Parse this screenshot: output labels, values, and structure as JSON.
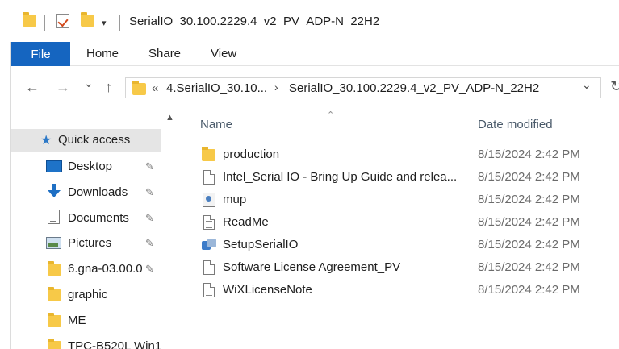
{
  "window": {
    "title": "SerialIO_30.100.2229.4_v2_PV_ADP-N_22H2",
    "quick_access_arrow": "▾"
  },
  "ribbon": {
    "tabs": [
      "File",
      "Home",
      "Share",
      "View"
    ]
  },
  "address": {
    "overflow": "«",
    "segments": [
      "4.SerialIO_30.10...",
      "SerialIO_30.100.2229.4_v2_PV_ADP-N_22H2"
    ],
    "separator": "›",
    "dropdown": "⌄"
  },
  "nav_buttons": {
    "back": "←",
    "forward": "→",
    "recent": "⌄",
    "up": "↑",
    "refresh": "↻"
  },
  "sidebar": {
    "quick_access_label": "Quick access",
    "items": [
      {
        "label": "Desktop",
        "icon": "desktop-icon",
        "pinned": true
      },
      {
        "label": "Downloads",
        "icon": "downloads-icon",
        "pinned": true
      },
      {
        "label": "Documents",
        "icon": "documents-icon",
        "pinned": true
      },
      {
        "label": "Pictures",
        "icon": "pictures-icon",
        "pinned": true
      },
      {
        "label": "6.gna-03.00.0",
        "icon": "folder-icon",
        "pinned": true
      },
      {
        "label": "graphic",
        "icon": "folder-icon",
        "pinned": false
      },
      {
        "label": "ME",
        "icon": "folder-icon",
        "pinned": false
      },
      {
        "label": "TPC-B520L Win1",
        "icon": "folder-icon",
        "pinned": false
      }
    ],
    "pin_glyph": "📌",
    "scroll_up": "▲"
  },
  "file_list": {
    "columns": [
      "Name",
      "Date modified"
    ],
    "sort_indicator": "⌃",
    "rows": [
      {
        "name": "production",
        "date": "8/15/2024 2:42 PM",
        "icon": "folder-icon"
      },
      {
        "name": "Intel_Serial IO - Bring Up Guide and relea...",
        "date": "8/15/2024 2:42 PM",
        "icon": "document-icon"
      },
      {
        "name": "mup",
        "date": "8/15/2024 2:42 PM",
        "icon": "config-file-icon"
      },
      {
        "name": "ReadMe",
        "date": "8/15/2024 2:42 PM",
        "icon": "text-file-icon"
      },
      {
        "name": "SetupSerialIO",
        "date": "8/15/2024 2:42 PM",
        "icon": "setup-exe-icon"
      },
      {
        "name": "Software License Agreement_PV",
        "date": "8/15/2024 2:42 PM",
        "icon": "document-icon"
      },
      {
        "name": "WiXLicenseNote",
        "date": "8/15/2024 2:42 PM",
        "icon": "text-file-icon"
      }
    ]
  },
  "colors": {
    "file_tab": "#1565c0",
    "folder": "#f7c948",
    "selected_row": "#e5e5e5"
  }
}
